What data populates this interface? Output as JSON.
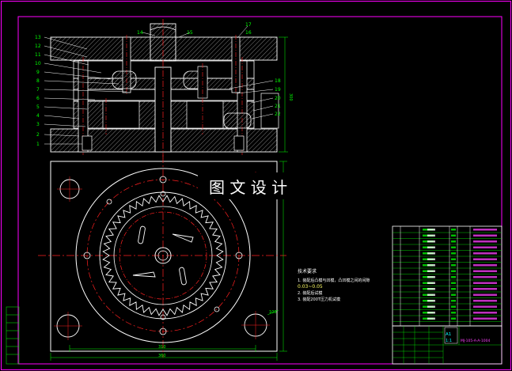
{
  "drawing": {
    "watermark": "图 文 设 计",
    "part_numbers_left": [
      "13",
      "12",
      "11",
      "10",
      "9",
      "8",
      "7",
      "6",
      "5",
      "4",
      "3",
      "2",
      "1"
    ],
    "part_numbers_top": [
      "14",
      "15",
      "17",
      "16"
    ],
    "part_numbers_right": [
      "18",
      "19",
      "20",
      "21",
      "22"
    ],
    "technical_requirements": {
      "title": "技术要求",
      "lines": [
        "1. 装配后凸模与凹模，凸凹模之间的间隙",
        "0.03~0.05",
        "2. 装配后试模",
        "3. 装配200T压力机试模"
      ]
    },
    "dimensions": {
      "width_bottom": "360",
      "width_inner": "310",
      "height_side": "300",
      "top_height": "100"
    },
    "title_block": {
      "scale": "1:1",
      "sheet": "A1",
      "drawing_no": "MJ-105-A-A-1004"
    }
  },
  "colors": {
    "background": "#000000",
    "frame": "#ff00ff",
    "line": "#ffffff",
    "center": "#ff2020",
    "dim": "#00ff00",
    "hatch": "#9a9a9a",
    "text_green": "#00ff00",
    "text_magenta": "#ff40ff",
    "text_white": "#ffffff",
    "text_cyan": "#00ffff"
  }
}
